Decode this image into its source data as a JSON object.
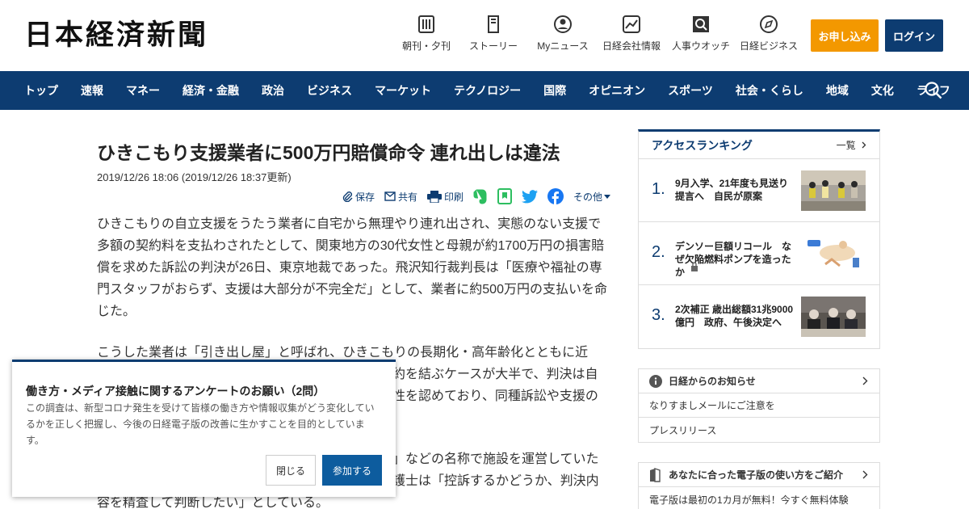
{
  "header": {
    "logo": "日本経済新聞",
    "nav": [
      {
        "label": "朝刊・夕刊",
        "icon": "newspaper-icon"
      },
      {
        "label": "ストーリー",
        "icon": "story-icon"
      },
      {
        "label": "Myニュース",
        "icon": "user-icon"
      },
      {
        "label": "日経会社情報",
        "icon": "chart-icon"
      },
      {
        "label": "人事ウオッチ",
        "icon": "search-person-icon"
      },
      {
        "label": "日経ビジネス",
        "icon": "compass-icon"
      }
    ],
    "subscribe_label": "お申し込み",
    "login_label": "ログイン",
    "colors": {
      "primary": "#0d3c71",
      "subscribe": "#f39800"
    }
  },
  "navbar": {
    "items": [
      "トップ",
      "速報",
      "マネー",
      "経済・金融",
      "政治",
      "ビジネス",
      "マーケット",
      "テクノロジー",
      "国際",
      "オピニオン",
      "スポーツ",
      "社会・くらし",
      "地域",
      "文化",
      "ライフ"
    ]
  },
  "article": {
    "title": "ひきこもり支援業者に500万円賠償命令 連れ出しは違法",
    "dateline": "2019/12/26 18:06 (2019/12/26 18:37更新)",
    "share": {
      "save": "保存",
      "share": "共有",
      "print": "印刷",
      "other": "その他"
    },
    "p1": "ひきこもりの自立支援をうたう業者に自宅から無理やり連れ出され、実態のない支援で多額の契約料を支払わされたとして、関東地方の30代女性と母親が約1700万円の損害賠償を求めた訴訟の判決が26日、東京地裁であった。飛沢知行裁判長は「医療や福祉の専門スタッフがおらず、支援は大部分が不完全だ」として、業者に約500万円の支払いを命じた。",
    "p2_line1": "こうした業者は「引き出し屋」と呼ばれ、ひきこもりの長期化・高年齢化とともに近",
    "p2_line2": "約を結ぶケースが大半で、判決は自",
    "p2_line3": "性を認めており、同種訴訟や支援の",
    "p3_line1": "」などの名称で施設を運営していた",
    "p3_line2": "護士は「控訴するかどうか、判決内",
    "p3_line3": "容を精査して判断したい」としている。"
  },
  "ranking": {
    "title": "アクセスランキング",
    "more": "一覧",
    "items": [
      {
        "num": "1.",
        "text": "9月入学、21年度も見送り提言へ　自民が原案"
      },
      {
        "num": "2.",
        "text": "デンソー巨額リコール　なぜ欠陥燃料ポンプを造ったか"
      },
      {
        "num": "3.",
        "text": "2次補正 歳出総額31兆9000億円　政府、午後決定へ"
      }
    ]
  },
  "notice": {
    "title": "日経からのお知らせ",
    "items": [
      "なりすましメールにご注意を",
      "プレスリリース"
    ]
  },
  "guide": {
    "title": "あなたに合った電子版の使い方をご紹介",
    "item": "電子版は最初の1カ月が無料！今すぐ無料体験"
  },
  "popup": {
    "title": "働き方・メディア接触に関するアンケートのお願い（2問）",
    "body": "この調査は、新型コロナ発生を受けて皆様の働き方や情報収集がどう変化しているかを正しく把握し、今後の日経電子版の改善に生かすことを目的としています。",
    "close_label": "閉じる",
    "join_label": "参加する"
  }
}
